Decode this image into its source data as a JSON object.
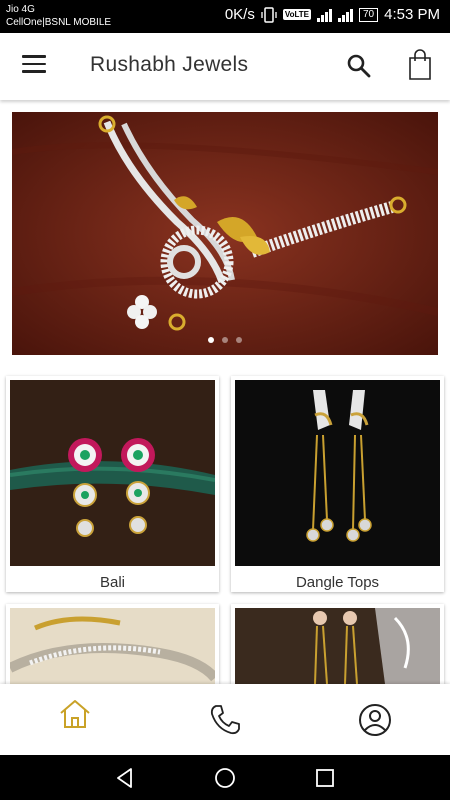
{
  "status_bar": {
    "carrier_line1": "Jio 4G",
    "carrier_line2": "CellOne|BSNL MOBILE",
    "network_speed": "0K/s",
    "volte": "VoLTE",
    "battery": "70",
    "time": "4:53 PM"
  },
  "app_bar": {
    "title": "Rushabh Jewels",
    "icons": [
      "menu-icon",
      "search-icon",
      "shopping-bag-icon"
    ]
  },
  "banner": {
    "slide_count": 3,
    "active_slide": 1
  },
  "categories": [
    {
      "label": "Bali"
    },
    {
      "label": "Dangle Tops"
    },
    {
      "label": ""
    },
    {
      "label": ""
    }
  ],
  "bottom_nav": {
    "items": [
      "home-icon",
      "phone-icon",
      "account-icon"
    ],
    "active": "home-icon",
    "active_color": "#c9a227"
  },
  "system_nav": [
    "back-icon",
    "home-circle-icon",
    "recents-icon"
  ]
}
